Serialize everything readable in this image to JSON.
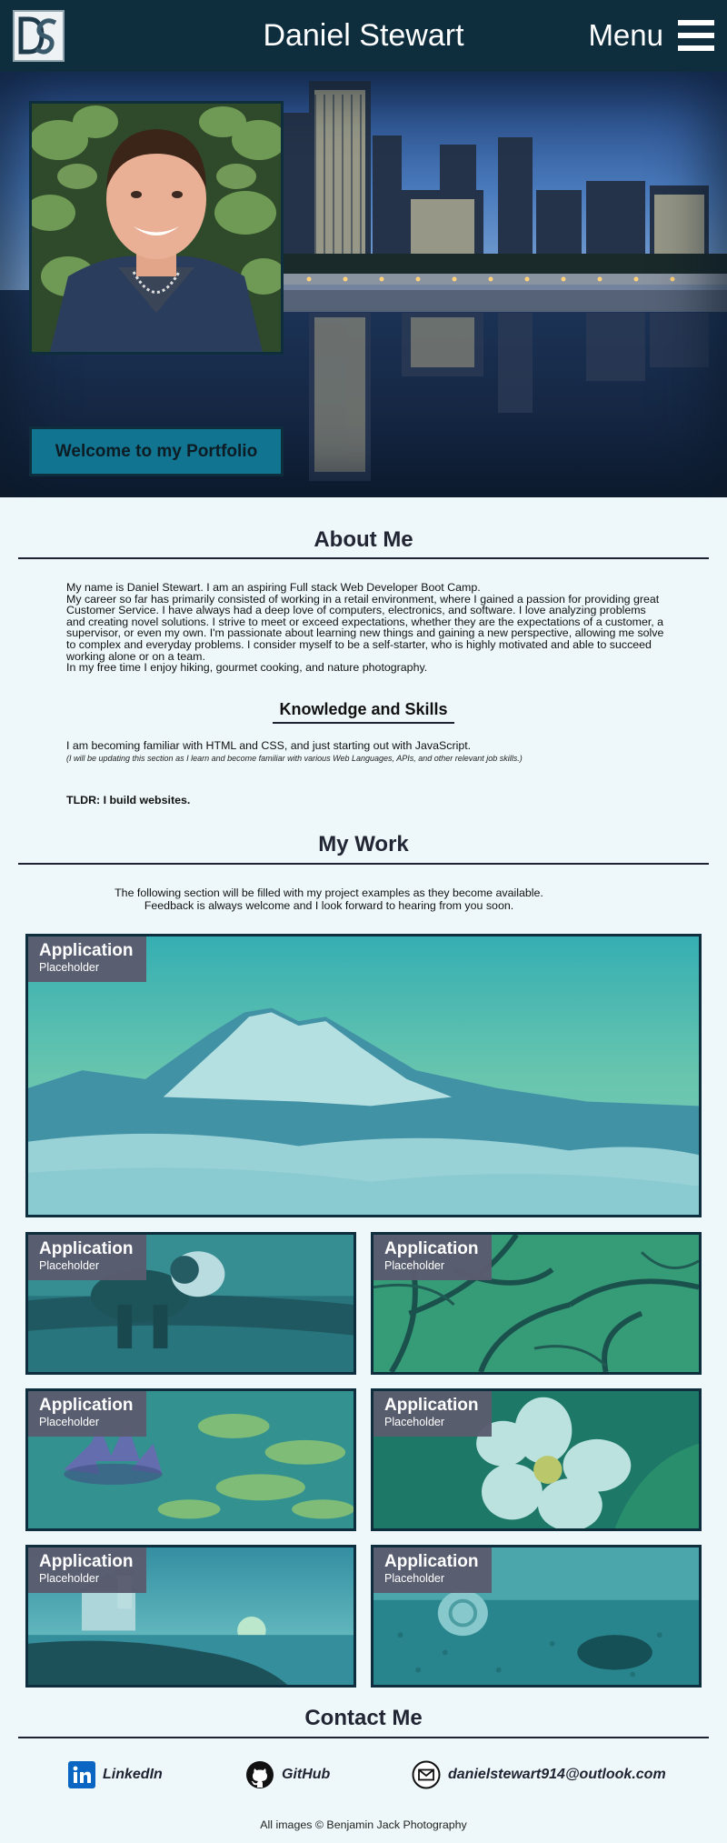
{
  "header": {
    "title": "Daniel Stewart",
    "menu_label": "Menu",
    "logo_icon": "ds-monogram-logo"
  },
  "hero": {
    "welcome_text": "Welcome to my Portfolio"
  },
  "about": {
    "title": "About Me",
    "lines": [
      "My name is Daniel Stewart. I am an aspiring Full stack Web Developer Boot Camp.",
      "My career so far has primarily consisted of working in a retail environment, where I gained a passion for providing great Customer Service. I have always had a deep love of computers, electronics, and software. I love analyzing problems and creating novel solutions. I strive to meet or exceed expectations, whether they are the expectations of a customer, a supervisor, or even my own. I'm passionate about learning new things and gaining a new perspective, allowing me solve to complex and everyday problems. I consider myself to be a self-starter, who is highly motivated and able to succeed working alone or on a team.",
      "In my free time I enjoy hiking, gourmet cooking, and nature photography."
    ]
  },
  "skills": {
    "title": "Knowledge and Skills",
    "text": "I am becoming familiar with HTML and CSS, and just starting out with JavaScript.",
    "note": "(I will be updating this section as I learn and become familiar with various Web Languages, APIs, and other relevant job skills.)",
    "tldr": "TLDR: I build websites."
  },
  "work": {
    "title": "My Work",
    "intro_line1": "The following section will be filled with my project examples as they become available.",
    "intro_line2": "Feedback is always welcome and I look forward to hearing from you soon.",
    "cards": [
      {
        "title": "Application",
        "subtitle": "Placeholder",
        "image": "mountain"
      },
      {
        "title": "Application",
        "subtitle": "Placeholder",
        "image": "red-panda"
      },
      {
        "title": "Application",
        "subtitle": "Placeholder",
        "image": "tree-branches"
      },
      {
        "title": "Application",
        "subtitle": "Placeholder",
        "image": "water-lily"
      },
      {
        "title": "Application",
        "subtitle": "Placeholder",
        "image": "plumeria-flower"
      },
      {
        "title": "Application",
        "subtitle": "Placeholder",
        "image": "lighthouse-sunset"
      },
      {
        "title": "Application",
        "subtitle": "Placeholder",
        "image": "seashell-beach"
      }
    ]
  },
  "contact": {
    "title": "Contact Me",
    "linkedin": "LinkedIn",
    "github": "GitHub",
    "email": "danielstewart914@outlook.com"
  },
  "footer": {
    "credit": "All images © Benjamin Jack Photography"
  },
  "colors": {
    "header_bg": "#0e2e3e",
    "page_bg": "#eef8fa",
    "welcome_bg": "#117490",
    "card_label_bg": "#5a5c6e",
    "linkedin_blue": "#0a66c2"
  }
}
